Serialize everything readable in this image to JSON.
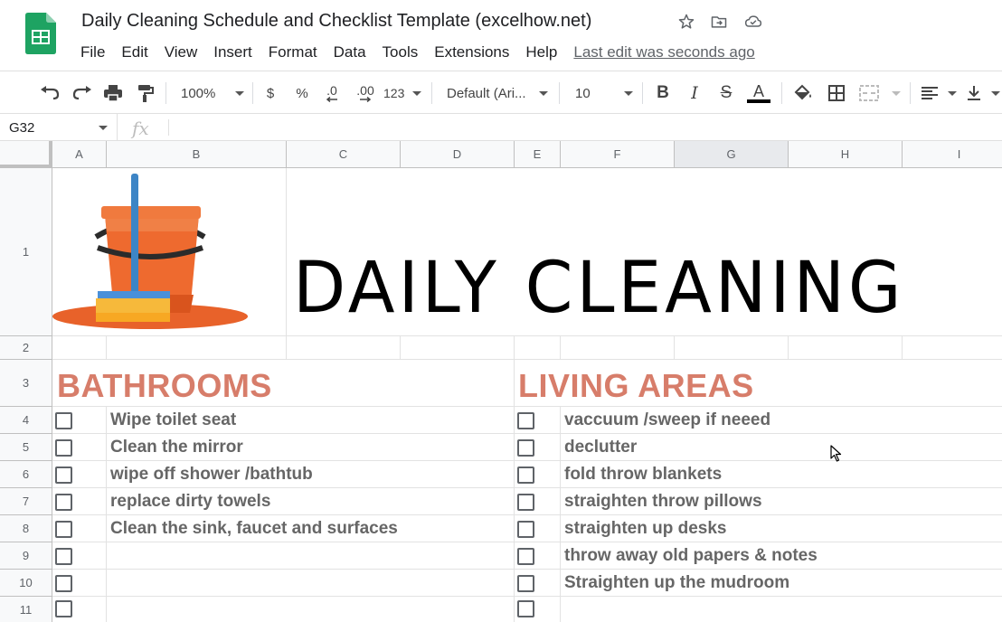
{
  "app": {
    "doc_title": "Daily Cleaning Schedule and Checklist Template (excelhow.net)",
    "title_icons": [
      "star-icon",
      "move-to-folder-icon",
      "cloud-status-icon"
    ],
    "menu": [
      "File",
      "Edit",
      "View",
      "Insert",
      "Format",
      "Data",
      "Tools",
      "Extensions",
      "Help"
    ],
    "last_edit": "Last edit was seconds ago"
  },
  "toolbar": {
    "zoom": "100%",
    "currency": "$",
    "percent": "%",
    "decrease_decimal": ".0",
    "increase_decimal": ".00",
    "more_formats": "123",
    "font": "Default (Ari...",
    "font_size": "10",
    "bold": "B",
    "italic": "I",
    "strike": "S",
    "text_color_letter": "A",
    "colors": {
      "text_color_bar": "#000000"
    }
  },
  "formula_bar": {
    "cell_ref": "G32",
    "fx": "fx",
    "value": ""
  },
  "grid": {
    "columns": [
      "A",
      "B",
      "C",
      "D",
      "E",
      "F",
      "G",
      "H",
      "I"
    ],
    "selected_column": "G",
    "rows": [
      "1",
      "2",
      "3",
      "4",
      "5",
      "6",
      "7",
      "8",
      "9",
      "10",
      "11"
    ]
  },
  "sheet": {
    "banner": "DAILY CLEANING",
    "image": "bucket-and-mop-image",
    "sections": [
      {
        "title": "BATHROOMS",
        "tasks": [
          {
            "label": "Wipe toilet seat",
            "checked": false
          },
          {
            "label": "Clean the mirror",
            "checked": false
          },
          {
            "label": "wipe off shower /bathtub",
            "checked": false
          },
          {
            "label": "replace dirty towels",
            "checked": false
          },
          {
            "label": "Clean the sink, faucet and surfaces",
            "checked": false
          },
          {
            "label": "",
            "checked": false
          },
          {
            "label": "",
            "checked": false
          },
          {
            "label": "",
            "checked": false
          }
        ]
      },
      {
        "title": "LIVING AREAS",
        "tasks": [
          {
            "label": "vaccuum /sweep if neeed",
            "checked": false
          },
          {
            "label": "declutter",
            "checked": false
          },
          {
            "label": "fold throw blankets",
            "checked": false
          },
          {
            "label": "straighten throw pillows",
            "checked": false
          },
          {
            "label": "straighten up desks",
            "checked": false
          },
          {
            "label": "throw away old papers & notes",
            "checked": false
          },
          {
            "label": "Straighten up the mudroom",
            "checked": false
          },
          {
            "label": "",
            "checked": false
          }
        ]
      }
    ],
    "colors": {
      "section_title": "#d77d6a",
      "task_text": "#666666",
      "bucket_orange": "#e8622a",
      "mop_handle": "#3d85c6",
      "sponge": "#f6b93b"
    }
  }
}
